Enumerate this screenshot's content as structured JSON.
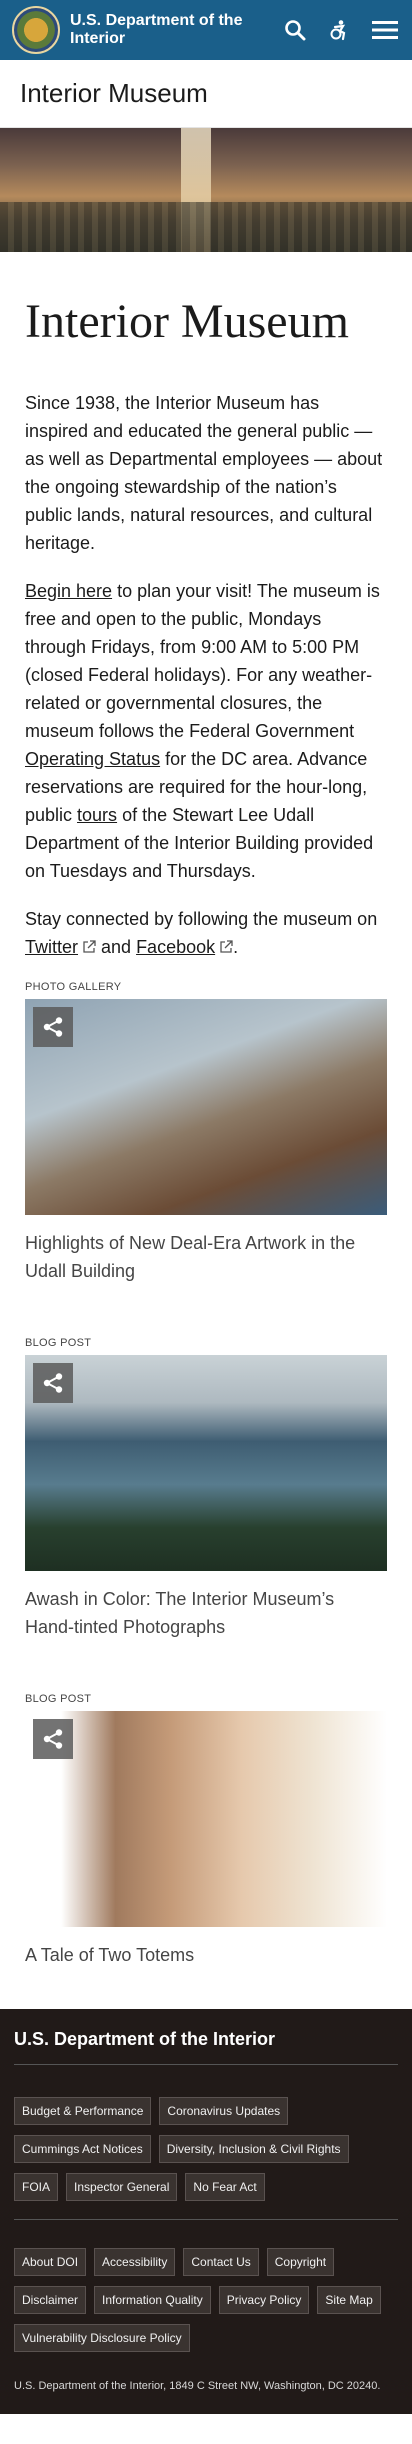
{
  "header": {
    "agency": "U.S. Department of the Interior",
    "icons": [
      "search-icon",
      "accessibility-icon",
      "menu-icon"
    ],
    "bg_color": "#1a5f8a"
  },
  "site_title": "Interior Museum",
  "page": {
    "heading": "Interior Museum",
    "intro": "Since 1938, the Interior Museum has inspired and educated the general public — as well as Departmental employees — about the ongoing stewardship of the nation’s public lands, natural resources, and cultural heritage.",
    "visit": {
      "link_begin": "Begin here",
      "text1": " to plan your visit! The museum is free and open to the public, Mondays through Fridays, from 9:00 AM to 5:00 PM (closed Federal holidays). For any weather-related or governmental closures, the museum follows the Federal Government ",
      "link_status": "Operating Status",
      "text2": " for the DC area. Advance reservations are required for the hour-long, public ",
      "link_tours": "tours",
      "text3": " of the Stewart Lee Udall Department of the Interior Building provided on Tuesdays and Thursdays."
    },
    "social": {
      "text1": "Stay connected by following the museum on ",
      "twitter": "Twitter",
      "text2": " and ",
      "facebook": "Facebook",
      "text3": "."
    }
  },
  "cards": [
    {
      "label": "PHOTO GALLERY",
      "title": "Highlights of New Deal-Era Artwork in the Udall Building"
    },
    {
      "label": "BLOG POST",
      "title": "Awash in Color: The Interior Museum’s Hand-tinted Photographs"
    },
    {
      "label": "BLOG POST",
      "title": "A Tale of Two Totems"
    }
  ],
  "footer": {
    "title": "U.S. Department of the Interior",
    "links_primary": [
      "Budget & Performance",
      "Coronavirus Updates",
      "Cummings Act Notices",
      "Diversity, Inclusion & Civil Rights",
      "FOIA",
      "Inspector General",
      "No Fear Act"
    ],
    "links_secondary": [
      "About DOI",
      "Accessibility",
      "Contact Us",
      "Copyright",
      "Disclaimer",
      "Information Quality",
      "Privacy Policy",
      "Site Map",
      "Vulnerability Disclosure Policy"
    ],
    "address": "U.S. Department of the Interior, 1849 C Street NW, Washington, DC 20240.",
    "bg_color": "#211a18"
  }
}
